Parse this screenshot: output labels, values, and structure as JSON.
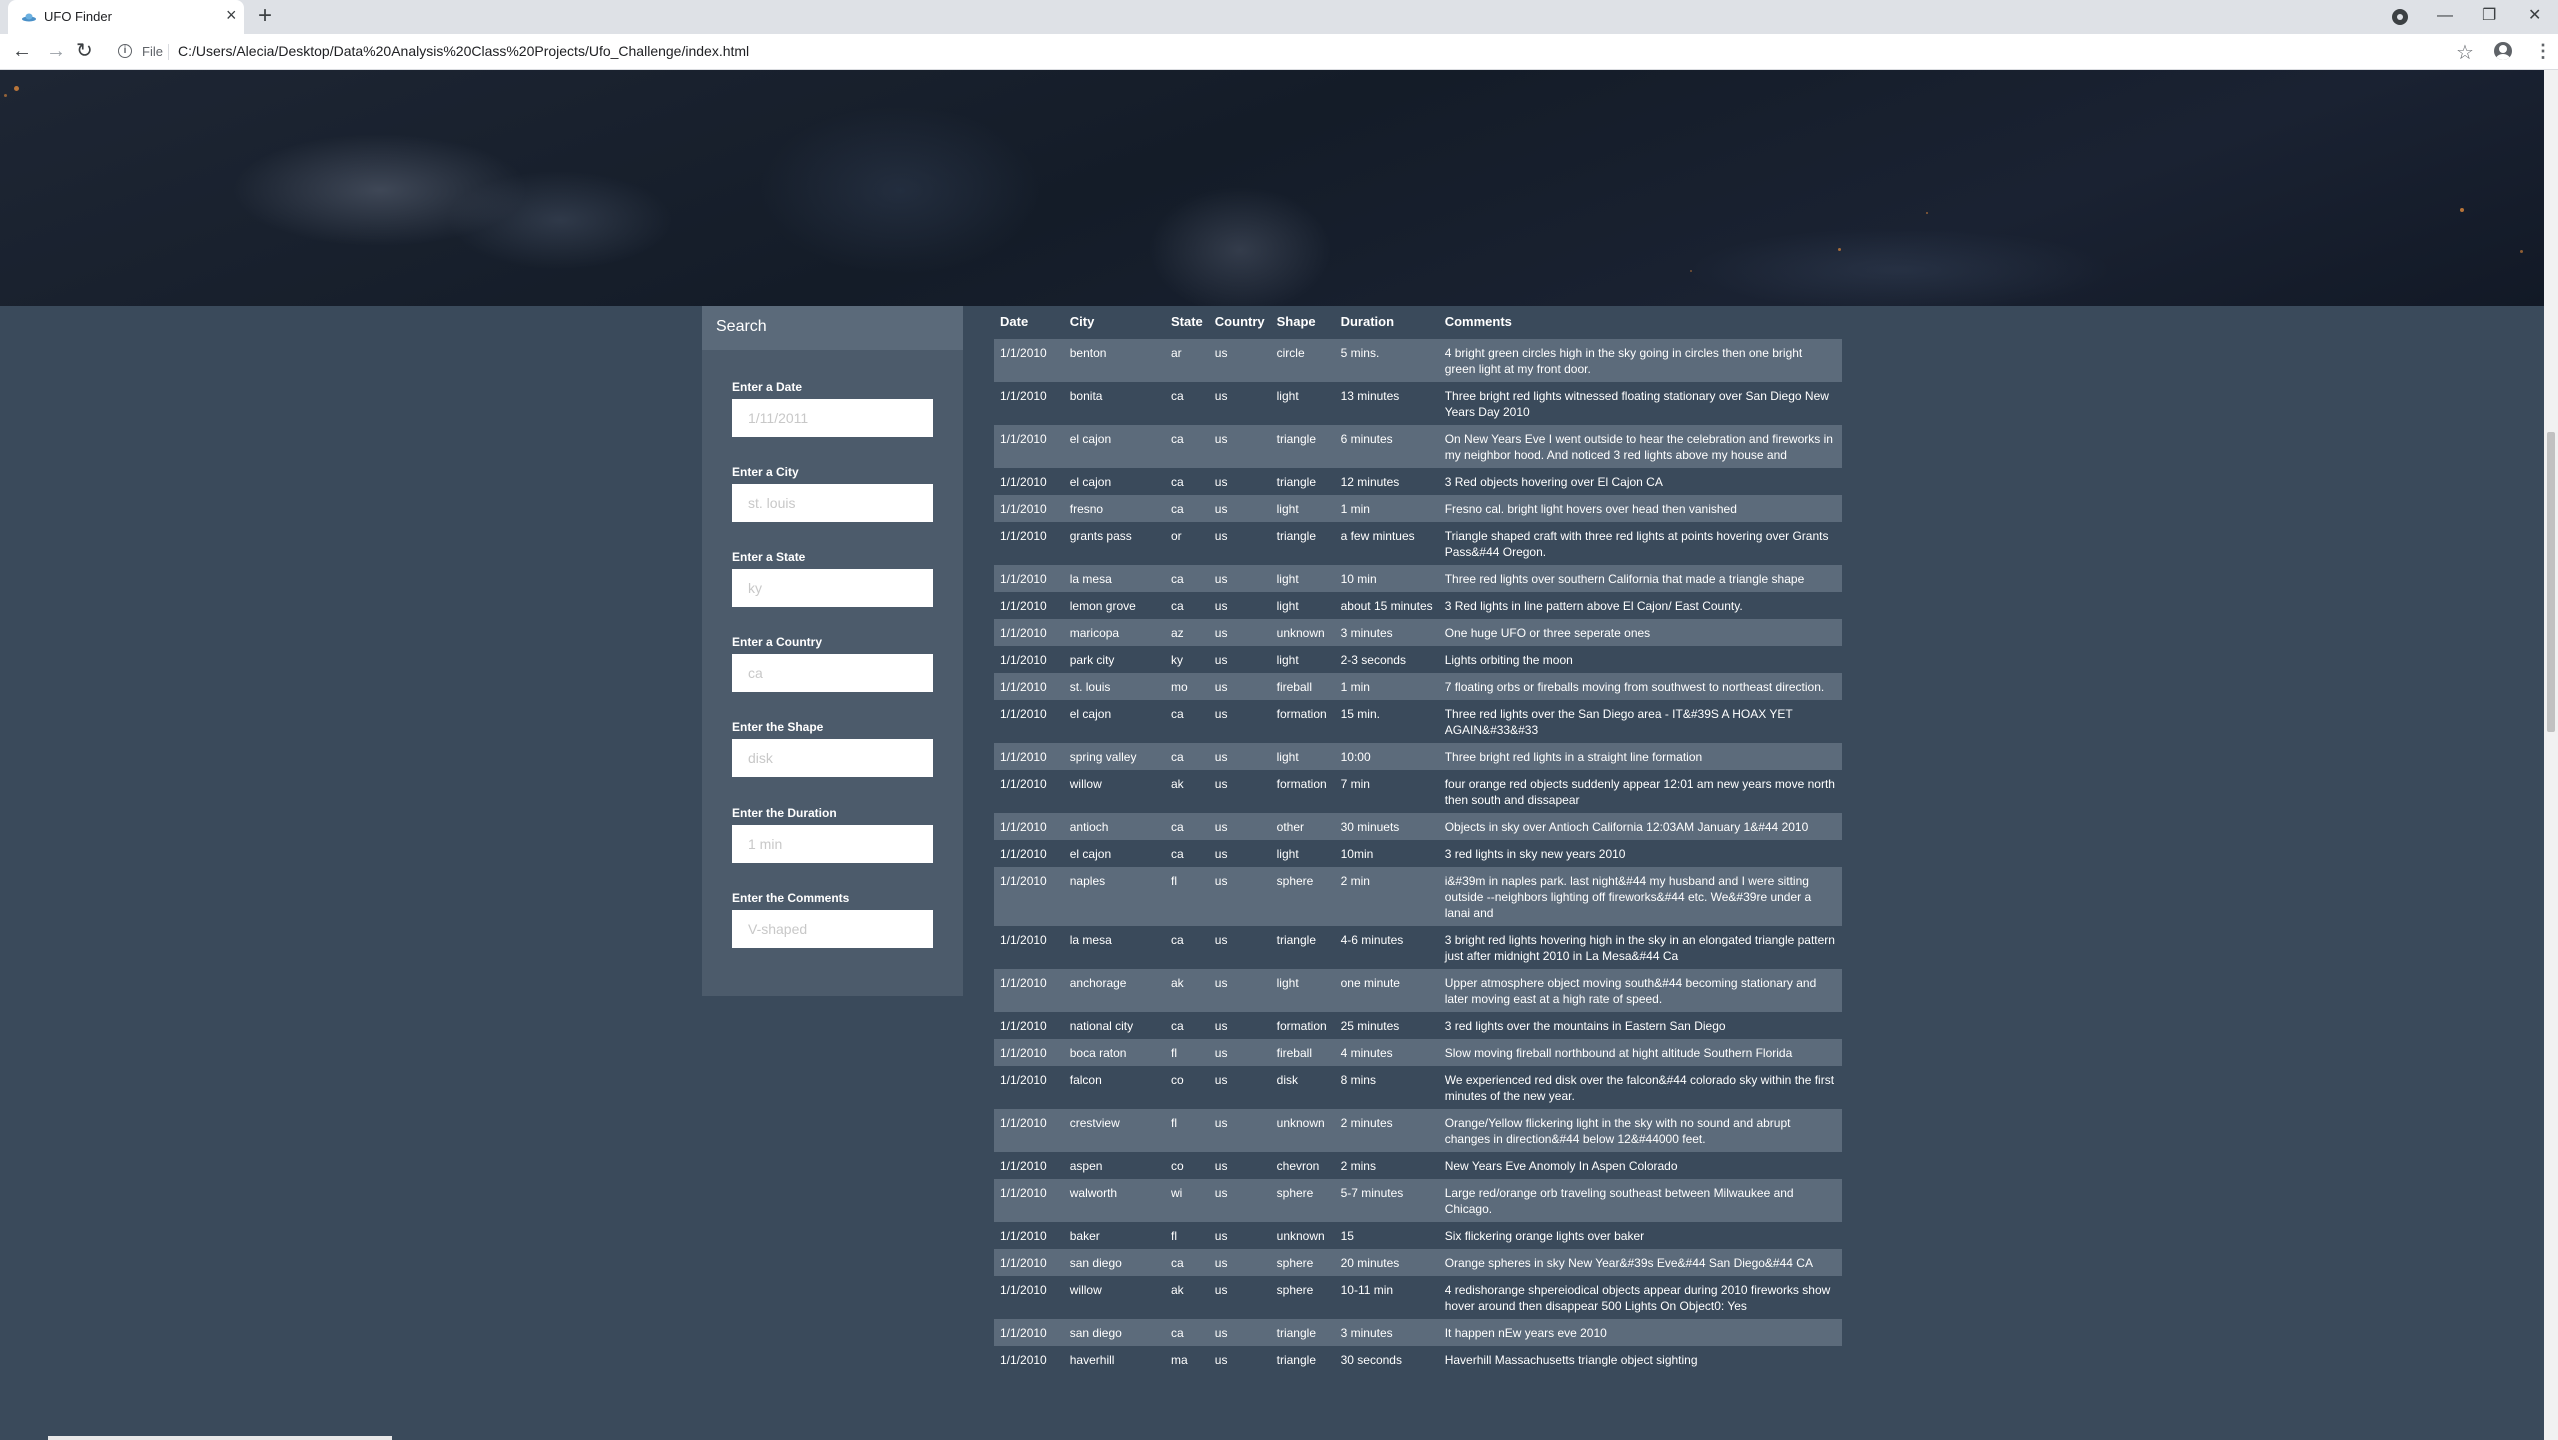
{
  "browser": {
    "tab_title": "UFO Finder",
    "tab_close": "×",
    "new_tab": "+",
    "minimize": "—",
    "maximize": "❐",
    "close": "✕",
    "back": "←",
    "forward": "→",
    "reload": "↻",
    "file_label": "File",
    "url": "C:/Users/Alecia/Desktop/Data%20Analysis%20Class%20Projects/Ufo_Challenge/index.html",
    "star": "☆",
    "menu": "⋮"
  },
  "filters": {
    "title": "Search",
    "fields": [
      {
        "label": "Enter a Date",
        "placeholder": "1/11/2011"
      },
      {
        "label": "Enter a City",
        "placeholder": "st. louis"
      },
      {
        "label": "Enter a State",
        "placeholder": "ky"
      },
      {
        "label": "Enter a Country",
        "placeholder": "ca"
      },
      {
        "label": "Enter the Shape",
        "placeholder": "disk"
      },
      {
        "label": "Enter the Duration",
        "placeholder": "1 min"
      },
      {
        "label": "Enter the Comments",
        "placeholder": "V-shaped"
      }
    ]
  },
  "table": {
    "headers": [
      "Date",
      "City",
      "State",
      "Country",
      "Shape",
      "Duration",
      "Comments"
    ],
    "rows": [
      [
        "1/1/2010",
        "benton",
        "ar",
        "us",
        "circle",
        "5 mins.",
        "4 bright green circles high in the sky going in circles then one bright green light at my front door."
      ],
      [
        "1/1/2010",
        "bonita",
        "ca",
        "us",
        "light",
        "13 minutes",
        "Three bright red lights witnessed floating stationary over San Diego New Years Day 2010"
      ],
      [
        "1/1/2010",
        "el cajon",
        "ca",
        "us",
        "triangle",
        "6 minutes",
        "On New Years Eve I went outside to hear the celebration and fireworks in my neighbor hood. And noticed 3 red lights above my house and"
      ],
      [
        "1/1/2010",
        "el cajon",
        "ca",
        "us",
        "triangle",
        "12 minutes",
        "3 Red objects hovering over El Cajon CA"
      ],
      [
        "1/1/2010",
        "fresno",
        "ca",
        "us",
        "light",
        "1 min",
        "Fresno cal. bright light hovers over head then vanished"
      ],
      [
        "1/1/2010",
        "grants pass",
        "or",
        "us",
        "triangle",
        "a few mintues",
        "Triangle shaped craft with three red lights at points hovering over Grants Pass&#44 Oregon."
      ],
      [
        "1/1/2010",
        "la mesa",
        "ca",
        "us",
        "light",
        "10 min",
        "Three red lights over southern California that made a triangle shape"
      ],
      [
        "1/1/2010",
        "lemon grove",
        "ca",
        "us",
        "light",
        "about 15 minutes",
        "3 Red lights in line pattern above El Cajon/ East County."
      ],
      [
        "1/1/2010",
        "maricopa",
        "az",
        "us",
        "unknown",
        "3 minutes",
        "One huge UFO or three seperate ones"
      ],
      [
        "1/1/2010",
        "park city",
        "ky",
        "us",
        "light",
        "2-3 seconds",
        "Lights orbiting the moon"
      ],
      [
        "1/1/2010",
        "st. louis",
        "mo",
        "us",
        "fireball",
        "1 min",
        "7 floating orbs or fireballs moving from southwest to northeast direction."
      ],
      [
        "1/1/2010",
        "el cajon",
        "ca",
        "us",
        "formation",
        "15 min.",
        "Three red lights over the San Diego area - IT&#39S A HOAX YET AGAIN&#33&#33"
      ],
      [
        "1/1/2010",
        "spring valley",
        "ca",
        "us",
        "light",
        "10:00",
        "Three bright red lights in a straight line formation"
      ],
      [
        "1/1/2010",
        "willow",
        "ak",
        "us",
        "formation",
        "7 min",
        "four orange red objects suddenly appear 12:01 am new years move north then south and dissapear"
      ],
      [
        "1/1/2010",
        "antioch",
        "ca",
        "us",
        "other",
        "30 minuets",
        "Objects in sky over Antioch California 12:03AM January 1&#44 2010"
      ],
      [
        "1/1/2010",
        "el cajon",
        "ca",
        "us",
        "light",
        "10min",
        "3 red lights in sky new years 2010"
      ],
      [
        "1/1/2010",
        "naples",
        "fl",
        "us",
        "sphere",
        "2 min",
        "i&#39m in naples park. last night&#44 my husband and I were sitting outside --neighbors lighting off fireworks&#44 etc. We&#39re under a lanai and"
      ],
      [
        "1/1/2010",
        "la mesa",
        "ca",
        "us",
        "triangle",
        "4-6 minutes",
        "3 bright red lights hovering high in the sky in an elongated triangle pattern just after midnight 2010 in La Mesa&#44 Ca"
      ],
      [
        "1/1/2010",
        "anchorage",
        "ak",
        "us",
        "light",
        "one minute",
        "Upper atmosphere object moving south&#44 becoming stationary and later moving east at a high rate of speed."
      ],
      [
        "1/1/2010",
        "national city",
        "ca",
        "us",
        "formation",
        "25 minutes",
        "3 red lights over the mountains in Eastern San Diego"
      ],
      [
        "1/1/2010",
        "boca raton",
        "fl",
        "us",
        "fireball",
        "4 minutes",
        "Slow moving fireball northbound at hight altitude Southern Florida"
      ],
      [
        "1/1/2010",
        "falcon",
        "co",
        "us",
        "disk",
        "8 mins",
        "We experienced red disk over the falcon&#44 colorado sky within the first minutes of the new year."
      ],
      [
        "1/1/2010",
        "crestview",
        "fl",
        "us",
        "unknown",
        "2 minutes",
        "Orange/Yellow flickering light in the sky with no sound and abrupt changes in direction&#44 below 12&#44000 feet."
      ],
      [
        "1/1/2010",
        "aspen",
        "co",
        "us",
        "chevron",
        "2 mins",
        "New Years Eve Anomoly In Aspen Colorado"
      ],
      [
        "1/1/2010",
        "walworth",
        "wi",
        "us",
        "sphere",
        "5-7 minutes",
        "Large red/orange orb traveling southeast between Milwaukee and Chicago."
      ],
      [
        "1/1/2010",
        "baker",
        "fl",
        "us",
        "unknown",
        "15",
        "Six flickering orange lights over baker"
      ],
      [
        "1/1/2010",
        "san diego",
        "ca",
        "us",
        "sphere",
        "20 minutes",
        "Orange spheres in sky New Year&#39s Eve&#44 San Diego&#44 CA"
      ],
      [
        "1/1/2010",
        "willow",
        "ak",
        "us",
        "sphere",
        "10-11 min",
        "4 redishorange shpereiodical objects appear during 2010 fireworks show hover around then disappear 500 Lights On Object0: Yes"
      ],
      [
        "1/1/2010",
        "san diego",
        "ca",
        "us",
        "triangle",
        "3 minutes",
        "It happen nEw years eve 2010"
      ],
      [
        "1/1/2010",
        "haverhill",
        "ma",
        "us",
        "triangle",
        "30 seconds",
        "Haverhill Massachusetts triangle object sighting"
      ]
    ]
  }
}
